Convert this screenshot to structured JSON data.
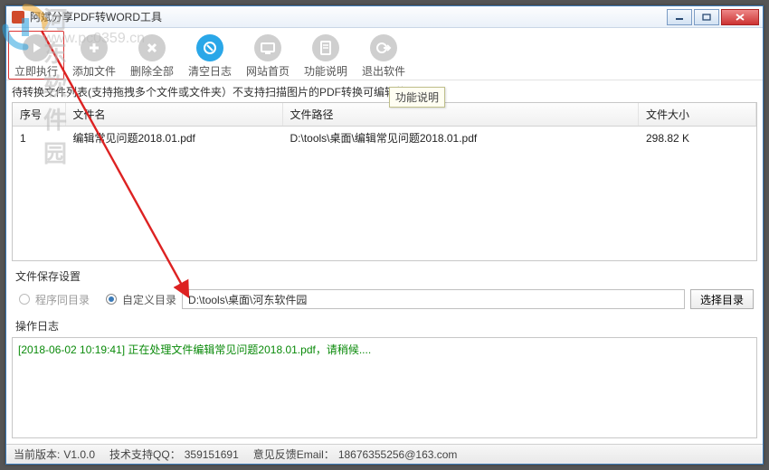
{
  "window": {
    "title": "阿斌分享PDF转WORD工具"
  },
  "toolbar": {
    "run": "立即执行",
    "add": "添加文件",
    "remove": "删除全部",
    "clear": "清空日志",
    "home": "网站首页",
    "help": "功能说明",
    "exit": "退出软件"
  },
  "tooltip": "功能说明",
  "hint": "待转换文件列表(支持拖拽多个文件或文件夹）不支持扫描图片的PDF转换可编辑的WORD",
  "table": {
    "headers": {
      "idx": "序号",
      "name": "文件名",
      "path": "文件路径",
      "size": "文件大小"
    },
    "rows": [
      {
        "idx": "1",
        "name": "编辑常见问题2018.01.pdf",
        "path": "D:\\tools\\桌面\\编辑常见问题2018.01.pdf",
        "size": "298.82 K"
      }
    ]
  },
  "save": {
    "section": "文件保存设置",
    "same_dir": "程序同目录",
    "custom_dir": "自定义目录",
    "path_value": "D:\\tools\\桌面\\河东软件园",
    "browse": "选择目录"
  },
  "log": {
    "section": "操作日志",
    "line": "[2018-06-02 10:19:41] 正在处理文件编辑常见问题2018.01.pdf，请稍候...."
  },
  "status": {
    "version_label": "当前版本:",
    "version": "V1.0.0",
    "support_label": "技术支持QQ：",
    "support": "359151691",
    "feedback_label": "意见反馈Email：",
    "feedback": "18676355256@163.com"
  },
  "watermark": {
    "text": "河东软件园",
    "url": "www.pc0359.cn"
  }
}
